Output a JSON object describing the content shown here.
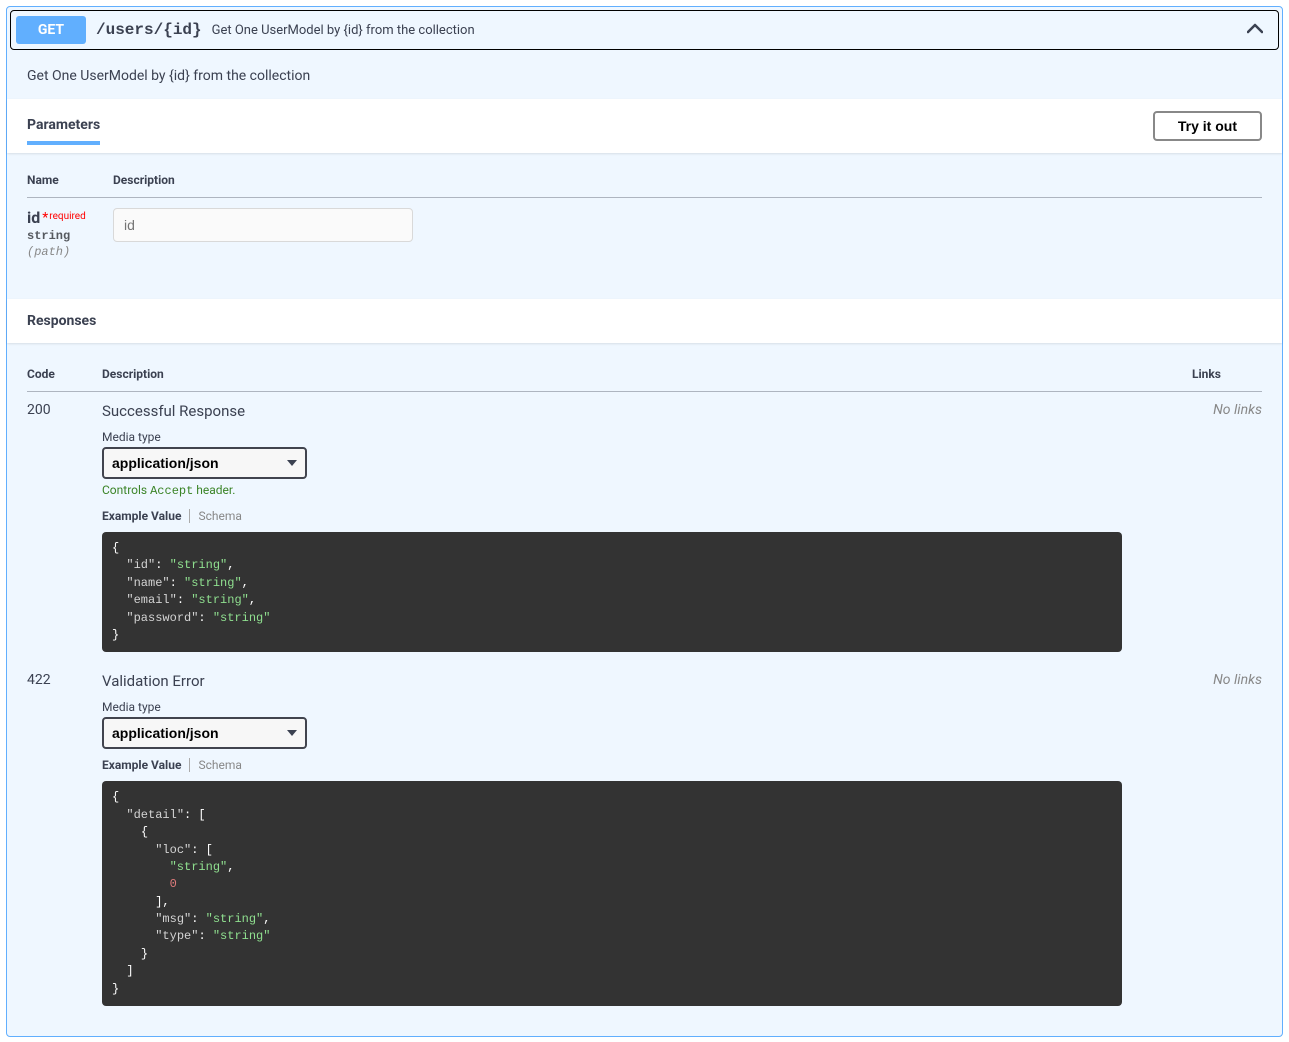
{
  "method": "GET",
  "path": "/users/{id}",
  "summary": "Get One UserModel by {id} from the collection",
  "description": "Get One UserModel by {id} from the collection",
  "sections": {
    "parameters": "Parameters",
    "responses": "Responses"
  },
  "try_it_out": "Try it out",
  "param_headers": {
    "name": "Name",
    "description": "Description"
  },
  "parameters": [
    {
      "name": "id",
      "required_label": "required",
      "type": "string",
      "in": "(path)",
      "placeholder": "id"
    }
  ],
  "response_headers": {
    "code": "Code",
    "description": "Description",
    "links": "Links"
  },
  "no_links": "No links",
  "media_type_label": "Media type",
  "media_type_value": "application/json",
  "accept_note_prefix": "Controls ",
  "accept_note_code": "Accept",
  "accept_note_suffix": " header.",
  "tab_example": "Example Value",
  "tab_schema": "Schema",
  "responses": [
    {
      "code": "200",
      "description": "Successful Response",
      "show_accept_note": true,
      "example": [
        {
          "t": "punc",
          "v": "{"
        },
        {
          "t": "nl",
          "v": "\n  "
        },
        {
          "t": "key",
          "v": "\"id\""
        },
        {
          "t": "punc",
          "v": ": "
        },
        {
          "t": "str",
          "v": "\"string\""
        },
        {
          "t": "punc",
          "v": ","
        },
        {
          "t": "nl",
          "v": "\n  "
        },
        {
          "t": "key",
          "v": "\"name\""
        },
        {
          "t": "punc",
          "v": ": "
        },
        {
          "t": "str",
          "v": "\"string\""
        },
        {
          "t": "punc",
          "v": ","
        },
        {
          "t": "nl",
          "v": "\n  "
        },
        {
          "t": "key",
          "v": "\"email\""
        },
        {
          "t": "punc",
          "v": ": "
        },
        {
          "t": "str",
          "v": "\"string\""
        },
        {
          "t": "punc",
          "v": ","
        },
        {
          "t": "nl",
          "v": "\n  "
        },
        {
          "t": "key",
          "v": "\"password\""
        },
        {
          "t": "punc",
          "v": ": "
        },
        {
          "t": "str",
          "v": "\"string\""
        },
        {
          "t": "nl",
          "v": "\n"
        },
        {
          "t": "punc",
          "v": "}"
        }
      ]
    },
    {
      "code": "422",
      "description": "Validation Error",
      "show_accept_note": false,
      "example": [
        {
          "t": "punc",
          "v": "{"
        },
        {
          "t": "nl",
          "v": "\n  "
        },
        {
          "t": "key",
          "v": "\"detail\""
        },
        {
          "t": "punc",
          "v": ": ["
        },
        {
          "t": "nl",
          "v": "\n    "
        },
        {
          "t": "punc",
          "v": "{"
        },
        {
          "t": "nl",
          "v": "\n      "
        },
        {
          "t": "key",
          "v": "\"loc\""
        },
        {
          "t": "punc",
          "v": ": ["
        },
        {
          "t": "nl",
          "v": "\n        "
        },
        {
          "t": "str",
          "v": "\"string\""
        },
        {
          "t": "punc",
          "v": ","
        },
        {
          "t": "nl",
          "v": "\n        "
        },
        {
          "t": "num",
          "v": "0"
        },
        {
          "t": "nl",
          "v": "\n      "
        },
        {
          "t": "punc",
          "v": "],"
        },
        {
          "t": "nl",
          "v": "\n      "
        },
        {
          "t": "key",
          "v": "\"msg\""
        },
        {
          "t": "punc",
          "v": ": "
        },
        {
          "t": "str",
          "v": "\"string\""
        },
        {
          "t": "punc",
          "v": ","
        },
        {
          "t": "nl",
          "v": "\n      "
        },
        {
          "t": "key",
          "v": "\"type\""
        },
        {
          "t": "punc",
          "v": ": "
        },
        {
          "t": "str",
          "v": "\"string\""
        },
        {
          "t": "nl",
          "v": "\n    "
        },
        {
          "t": "punc",
          "v": "}"
        },
        {
          "t": "nl",
          "v": "\n  "
        },
        {
          "t": "punc",
          "v": "]"
        },
        {
          "t": "nl",
          "v": "\n"
        },
        {
          "t": "punc",
          "v": "}"
        }
      ]
    }
  ]
}
